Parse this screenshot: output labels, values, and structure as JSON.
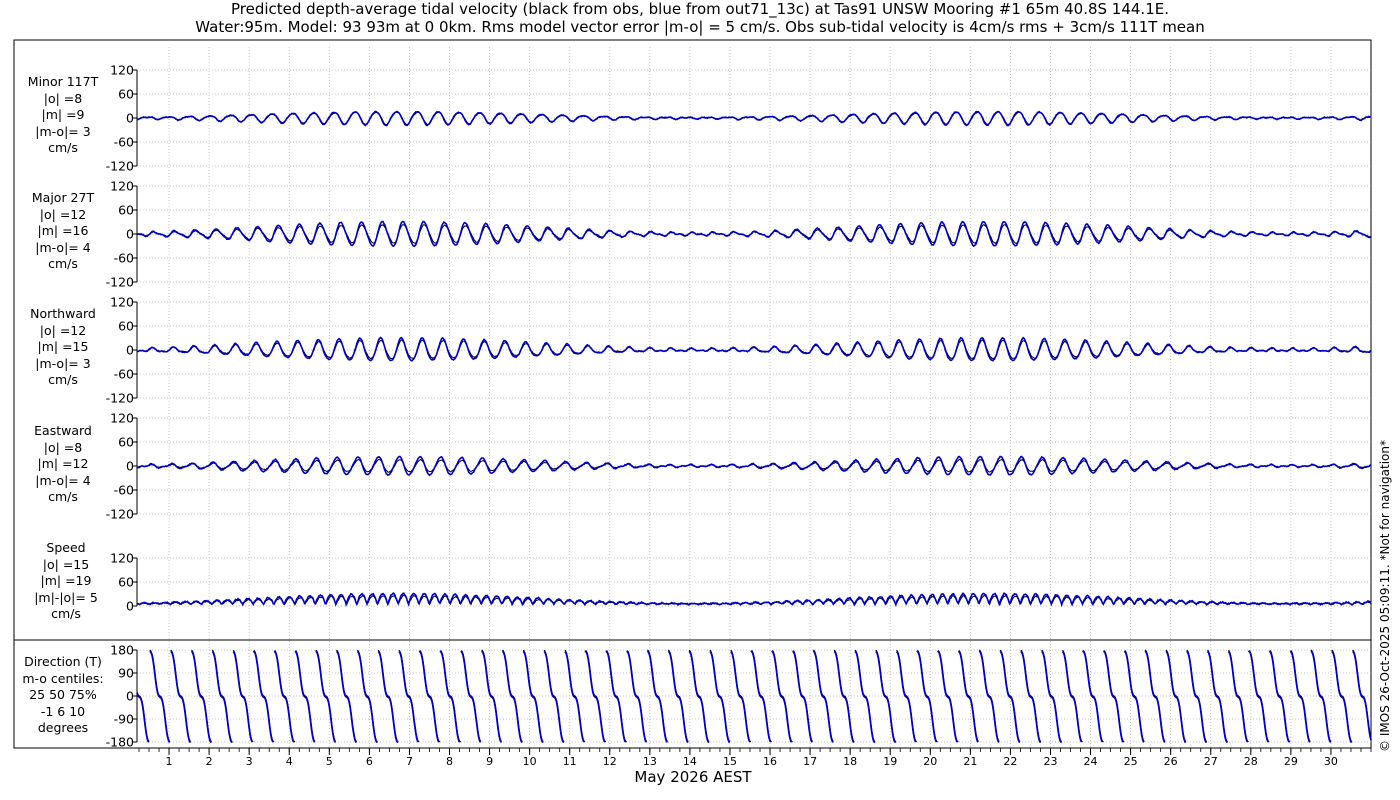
{
  "title_line1": "Predicted depth-average tidal velocity (black from obs, blue from out71_13c) at Tas91 UNSW Mooring #1 65m 40.8S 144.1E.",
  "title_line2": "Water:95m. Model: 93 93m at 0 0km. Rms model vector error |m-o| = 5 cm/s. Obs sub-tidal velocity is 4cm/s rms + 3cm/s 111T mean",
  "credit": "© IMOS 26-Oct-2025 05:09:11. *Not for navigation*",
  "chart_data": {
    "type": "line",
    "xlabel": "May 2026 AEST",
    "x_ticks": [
      "1",
      "2",
      "3",
      "4",
      "5",
      "6",
      "7",
      "8",
      "9",
      "10",
      "11",
      "12",
      "13",
      "14",
      "15",
      "16",
      "17",
      "18",
      "19",
      "20",
      "21",
      "22",
      "23",
      "24",
      "25",
      "26",
      "27",
      "28",
      "29",
      "30"
    ],
    "x_range_days": [
      0.2,
      31.0
    ],
    "series_colors": {
      "obs": "#000000",
      "model": "#0000cc"
    },
    "grid": true,
    "panels": [
      {
        "key": "minor",
        "label_lines": [
          "Minor 117T",
          "|o| =8",
          "|m| =9",
          "|m-o|= 3",
          "cm/s"
        ],
        "y_ticks": [
          "120",
          "60",
          "0",
          "-60",
          "-120"
        ],
        "ylim": [
          -120,
          120
        ],
        "amplitude_obs": 8,
        "amplitude_model": 9
      },
      {
        "key": "major",
        "label_lines": [
          "Major 27T",
          "|o| =12",
          "|m| =16",
          "|m-o|= 4",
          "cm/s"
        ],
        "y_ticks": [
          "120",
          "60",
          "0",
          "-60",
          "-120"
        ],
        "ylim": [
          -120,
          120
        ],
        "amplitude_obs": 12,
        "amplitude_model": 16
      },
      {
        "key": "north",
        "label_lines": [
          "Northward",
          "|o| =12",
          "|m| =15",
          "|m-o|= 3",
          "cm/s"
        ],
        "y_ticks": [
          "120",
          "60",
          "0",
          "-60",
          "-120"
        ],
        "ylim": [
          -120,
          120
        ],
        "amplitude_obs": 12,
        "amplitude_model": 15
      },
      {
        "key": "east",
        "label_lines": [
          "Eastward",
          "|o| =8",
          "|m| =12",
          "|m-o|= 4",
          "cm/s"
        ],
        "y_ticks": [
          "120",
          "60",
          "0",
          "-60",
          "-120"
        ],
        "ylim": [
          -120,
          120
        ],
        "amplitude_obs": 8,
        "amplitude_model": 12
      },
      {
        "key": "speed",
        "label_lines": [
          "Speed",
          "|o| =15",
          "|m| =19",
          "|m|-|o|= 5",
          "cm/s"
        ],
        "y_ticks": [
          "120",
          "60",
          "0"
        ],
        "ylim": [
          0,
          120
        ],
        "amplitude_obs": 15,
        "amplitude_model": 19
      },
      {
        "key": "direction",
        "label_lines": [
          "Direction (T)",
          "m-o centiles:",
          "25  50  75%",
          "-1  6 10",
          "degrees"
        ],
        "y_ticks": [
          "180",
          "90",
          "0",
          "-90",
          "-180"
        ],
        "ylim": [
          -180,
          180
        ]
      }
    ]
  }
}
